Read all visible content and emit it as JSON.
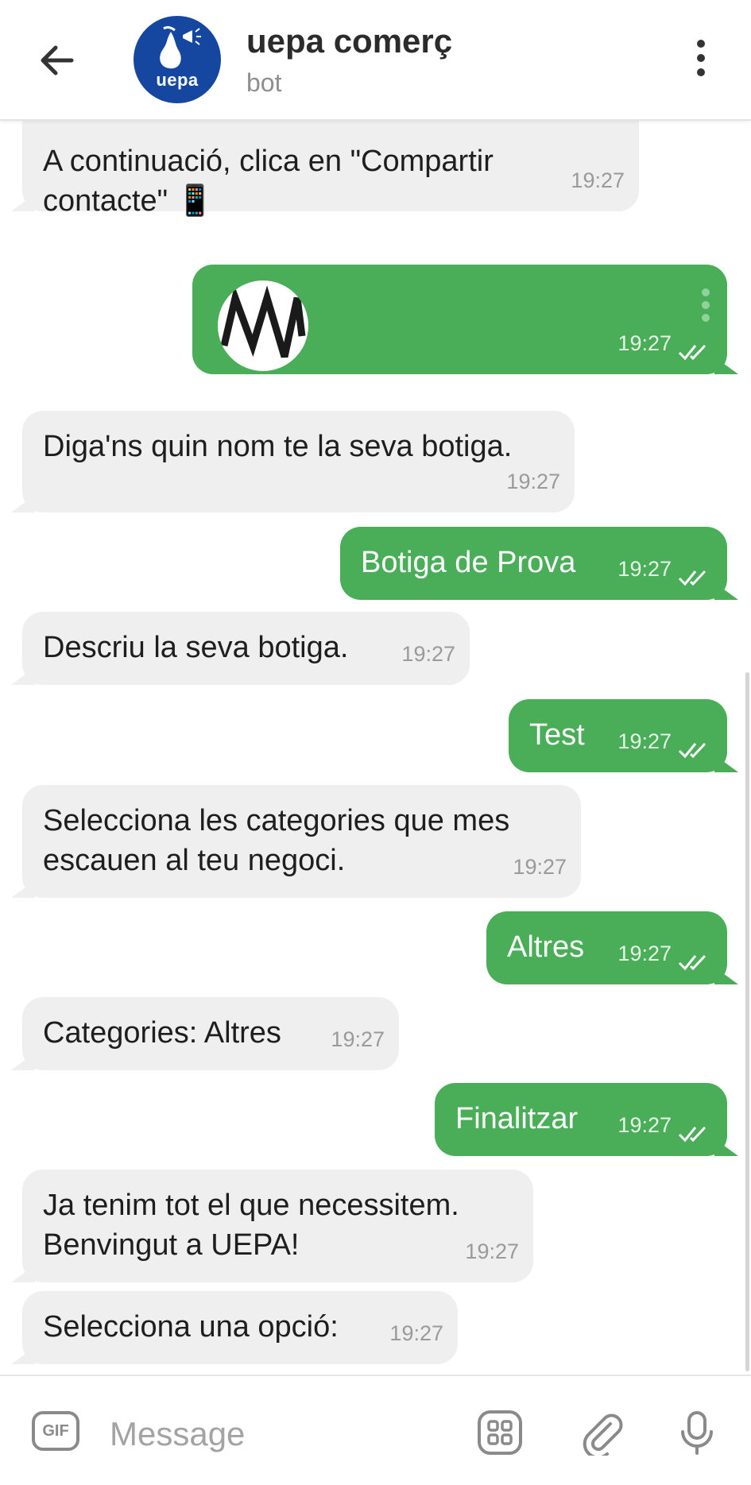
{
  "header": {
    "title": "uepa comerç",
    "subtitle": "bot",
    "avatar_text": "uepa",
    "back_icon": "arrow-left-icon",
    "menu_icon": "more-vertical-icon"
  },
  "messages": [
    {
      "dir": "in",
      "lines": [
        "A continuació, clica en \"Compartir",
        "contacte\" 📱"
      ],
      "time": "19:27"
    },
    {
      "dir": "out",
      "type": "contact",
      "time": "19:27"
    },
    {
      "dir": "in",
      "lines": [
        "Diga'ns quin nom te la seva botiga."
      ],
      "time": "19:27"
    },
    {
      "dir": "out",
      "text": "Botiga de Prova",
      "time": "19:27"
    },
    {
      "dir": "in",
      "lines": [
        "Descriu la seva botiga."
      ],
      "time": "19:27"
    },
    {
      "dir": "out",
      "text": "Test",
      "time": "19:27"
    },
    {
      "dir": "in",
      "lines": [
        "Selecciona les categories que mes",
        "escauen al teu negoci."
      ],
      "time": "19:27"
    },
    {
      "dir": "out",
      "text": "Altres",
      "time": "19:27"
    },
    {
      "dir": "in",
      "lines": [
        "Categories: Altres"
      ],
      "time": "19:27"
    },
    {
      "dir": "out",
      "text": "Finalitzar",
      "time": "19:27"
    },
    {
      "dir": "in",
      "lines": [
        "Ja tenim tot el que necessitem.",
        "Benvingut a UEPA!"
      ],
      "time": "19:27"
    },
    {
      "dir": "in",
      "lines": [
        "Selecciona una opció:"
      ],
      "time": "19:27"
    }
  ],
  "input": {
    "placeholder": "Message",
    "gif_label": "GIF"
  },
  "colors": {
    "outgoing": "#4aad57",
    "incoming": "#efefef",
    "avatar": "#1546a0"
  }
}
